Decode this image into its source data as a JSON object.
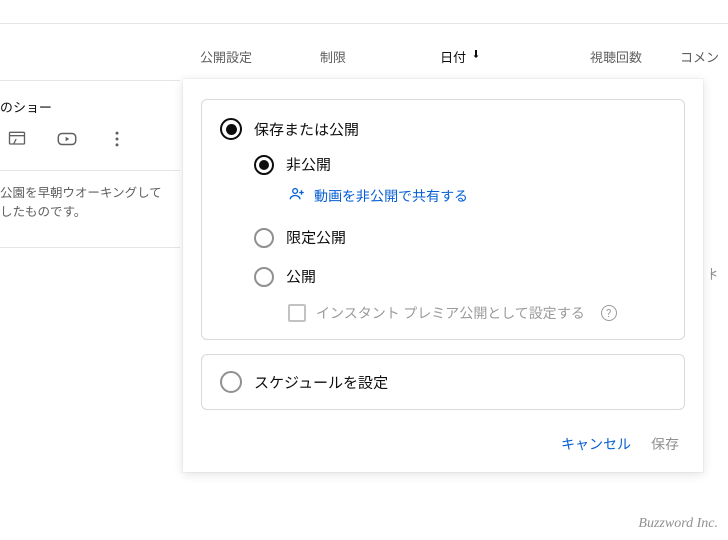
{
  "columns": {
    "visibility": "公開設定",
    "restriction": "制限",
    "date": "日付",
    "views": "視聴回数",
    "comments": "コメン"
  },
  "left": {
    "title": "のショー",
    "desc_line1": "公園を早朝ウオーキングして",
    "desc_line2": "したものです。"
  },
  "popover": {
    "save_or_publish": "保存または公開",
    "private": "非公開",
    "share_private": "動画を非公開で共有する",
    "unlisted": "限定公開",
    "public": "公開",
    "instant_premiere": "インスタント プレミア公開として設定する",
    "help": "?",
    "schedule": "スケジュールを設定",
    "cancel": "キャンセル",
    "save": "保存"
  },
  "pager": "|<",
  "watermark": "Buzzword Inc."
}
